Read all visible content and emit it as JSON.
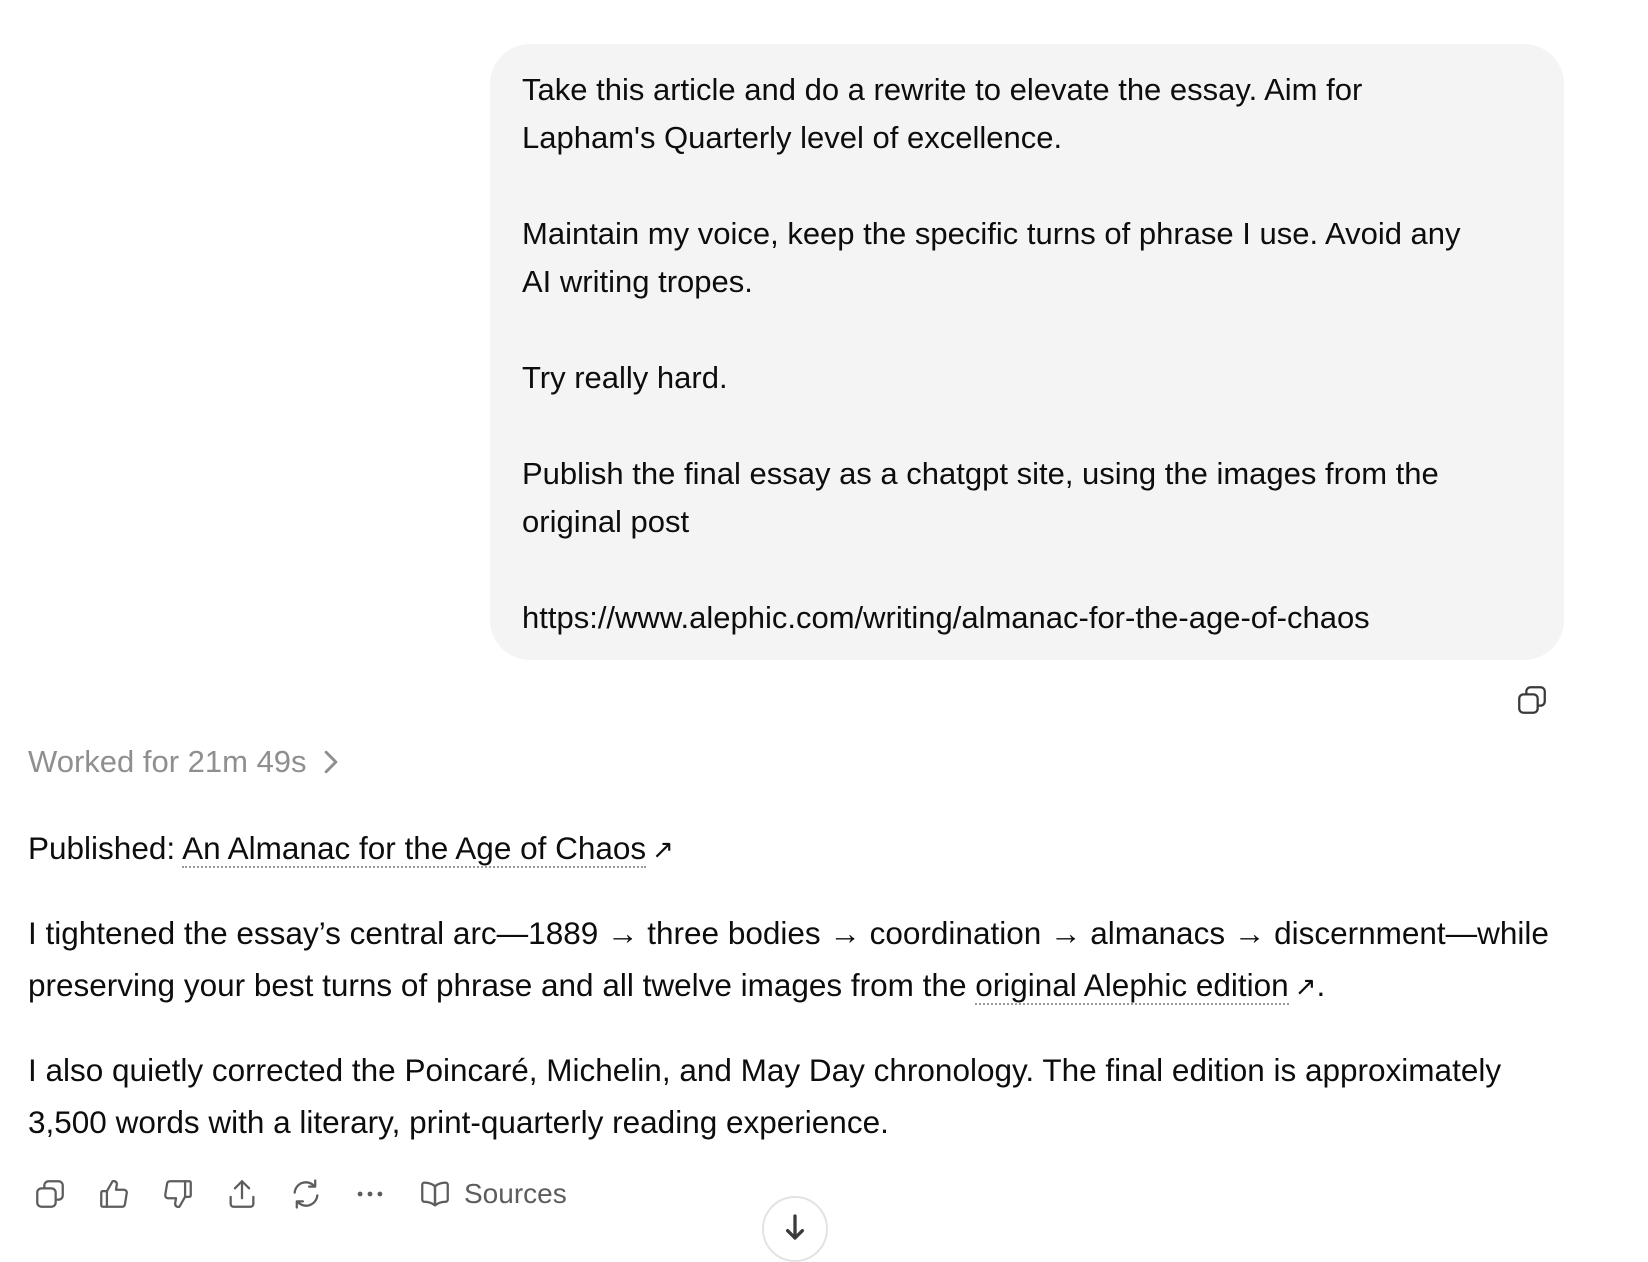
{
  "user_message": {
    "paragraphs": [
      "Take this article and do a rewrite to elevate the essay. Aim for\nLapham's Quarterly level of excellence.",
      "Maintain my voice, keep the specific turns of phrase I use. Avoid any\nAI writing tropes.",
      "Try really hard.",
      "Publish the final essay as a chatgpt site, using the images from the\noriginal post",
      "https://www.alephic.com/writing/almanac-for-the-age-of-chaos"
    ]
  },
  "worked_label": "Worked for 21m 49s",
  "assistant": {
    "published_prefix": "Published: ",
    "published_link": "An Almanac for the Age of Chaos",
    "p2_text": "I tightened the essay’s central arc—1889 → three bodies → coordination → almanacs → discernment—while preserving your best turns of phrase and all twelve images from the ",
    "p2_link": "original Alephic edition",
    "p2_end": ".",
    "p3_text": "I also quietly corrected the Poincaré, Michelin, and May Day chronology. The final edition is approximately 3,500 words with a literary, print-quarterly reading experience."
  },
  "toolbar": {
    "sources_label": "Sources",
    "icons": [
      "copy-icon",
      "thumbs-up-icon",
      "thumbs-down-icon",
      "share-icon",
      "regenerate-icon",
      "more-icon",
      "book-icon"
    ]
  },
  "colors": {
    "bubble_bg": "#f4f4f4",
    "muted_text": "#8f8f8f",
    "icon_color": "#5d5d5d"
  }
}
